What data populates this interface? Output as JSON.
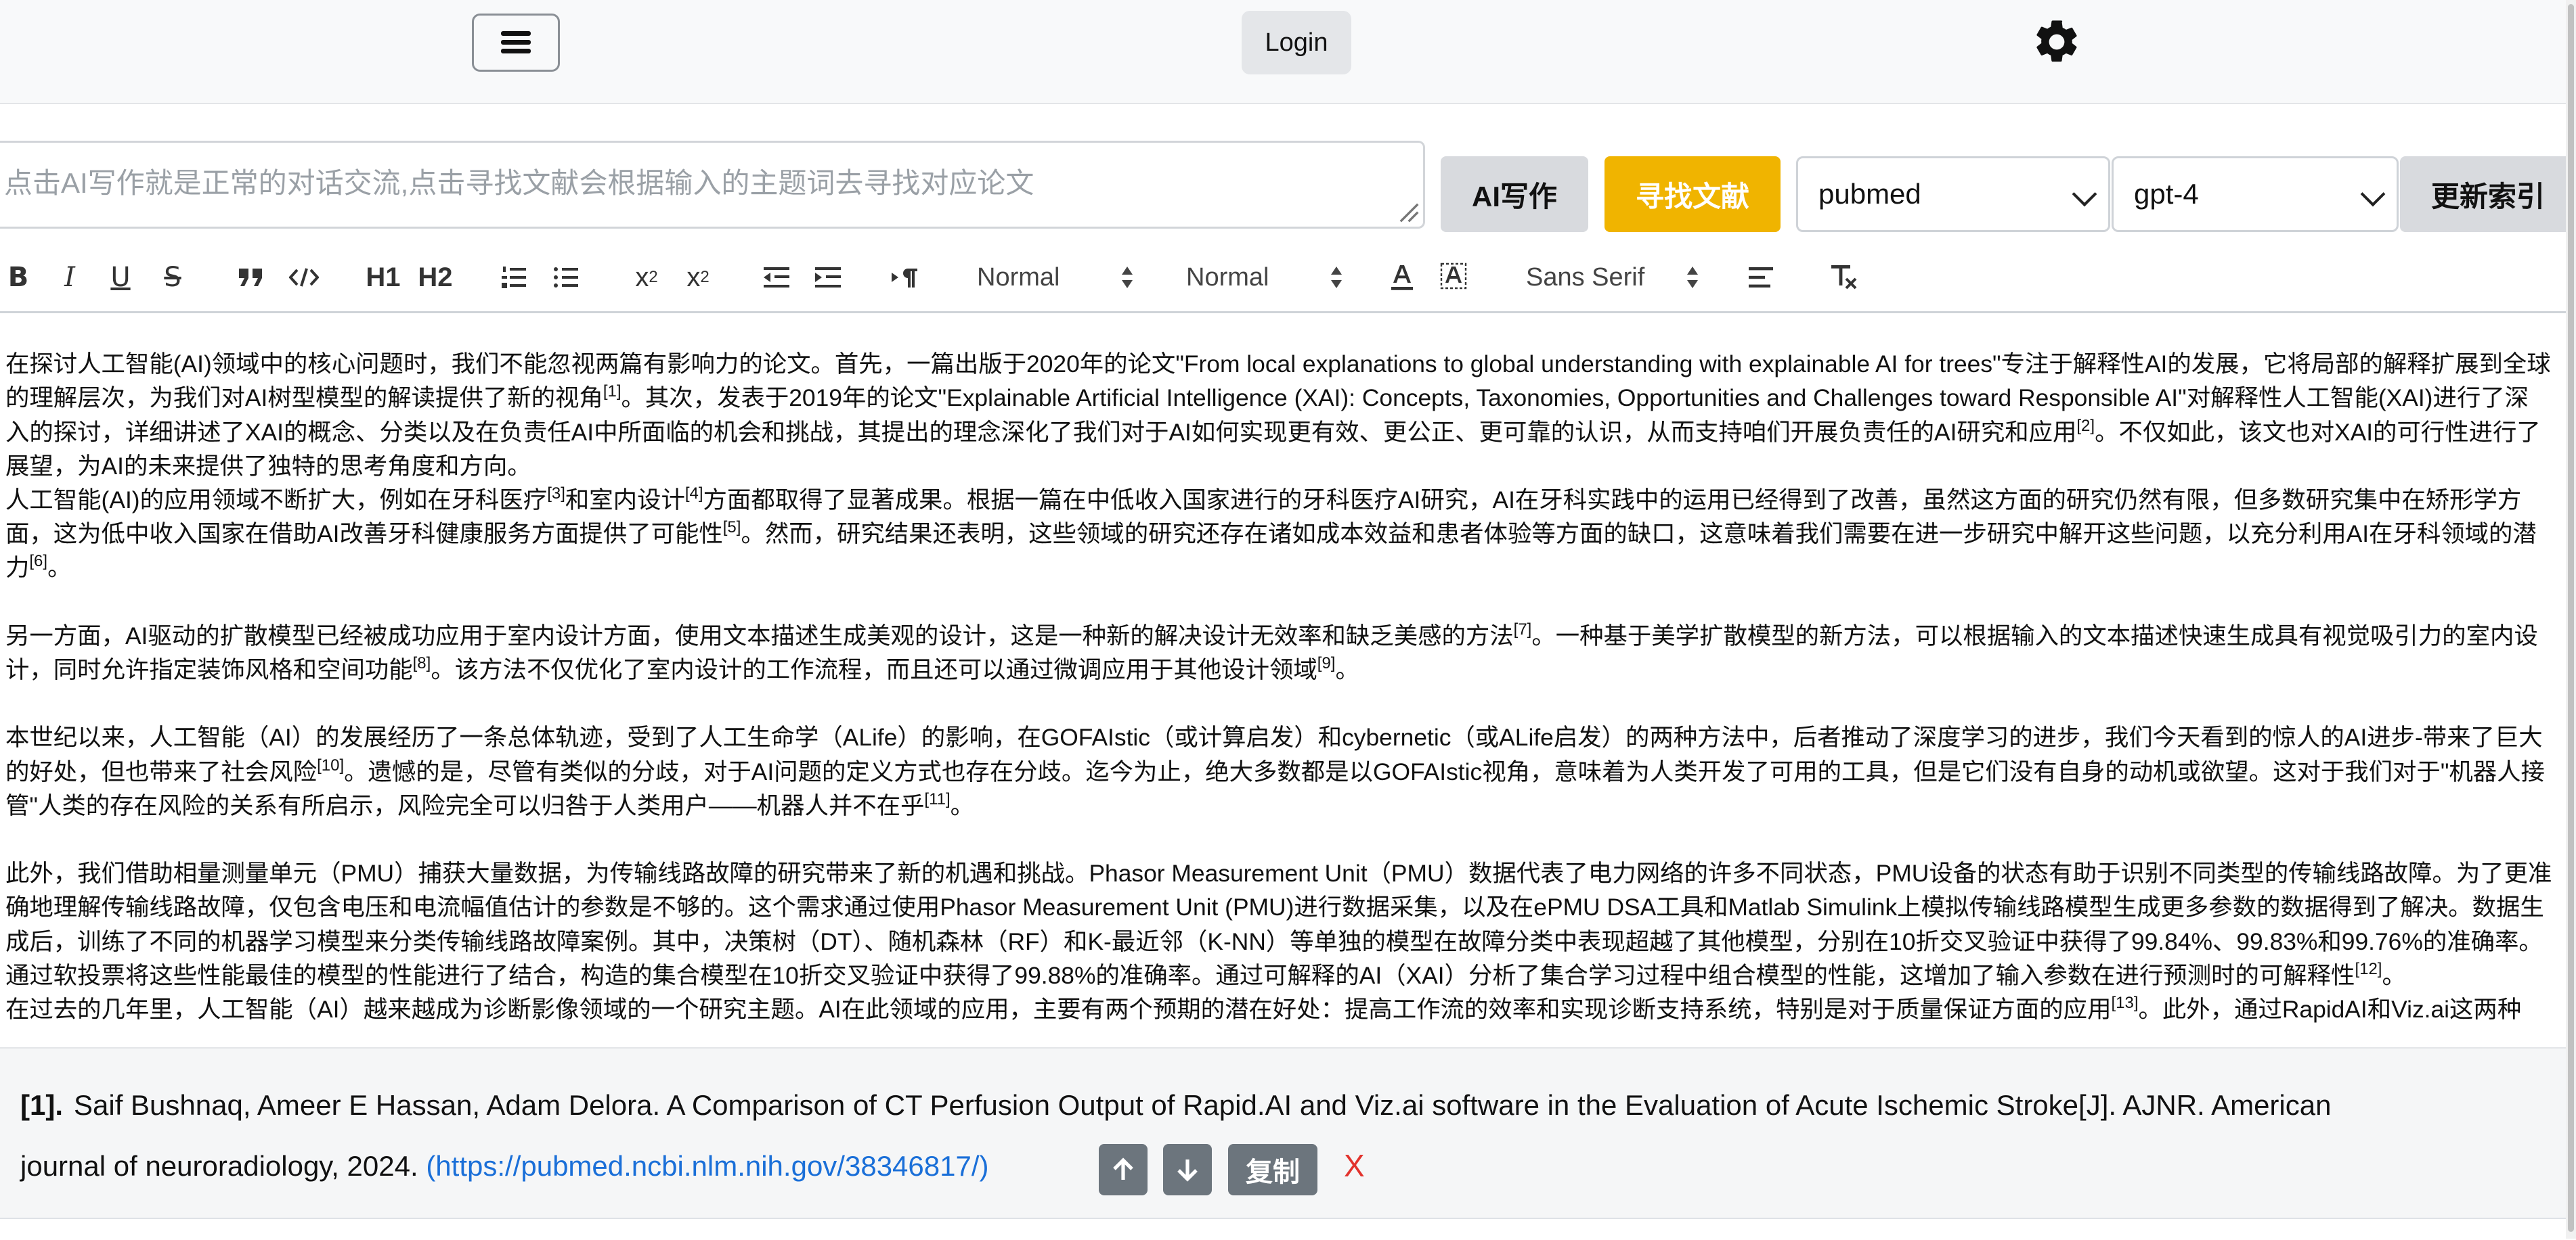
{
  "nav": {
    "login_label": "Login"
  },
  "prompt": {
    "placeholder": "点击AI写作就是正常的对话交流,点击寻找文献会根据输入的主题词去寻找对应论文",
    "value": ""
  },
  "actions": {
    "write_label": "AI写作",
    "find_label": "寻找文献",
    "reindex_label": "更新索引"
  },
  "selects": {
    "database": "pubmed",
    "model": "gpt-4"
  },
  "toolbar": {
    "bold": "B",
    "italic": "I",
    "underline": "U",
    "strike": "S",
    "h1": "H1",
    "h2": "H2",
    "sub": "x2",
    "sup": "x2",
    "size_picker": "Normal",
    "header_picker": "Normal",
    "font_picker": "Sans Serif"
  },
  "icons": [
    "menu-icon",
    "gear-icon",
    "blockquote-icon",
    "code-icon",
    "ordered-list-icon",
    "bullet-list-icon",
    "outdent-icon",
    "indent-icon",
    "rtl-icon",
    "text-color-icon",
    "background-color-icon",
    "align-icon",
    "clear-format-icon",
    "arrow-up-icon",
    "arrow-down-icon",
    "close-icon"
  ],
  "colors": {
    "accent": "#f0b400",
    "link": "#1a6fd8",
    "close": "#e2332d",
    "secondary": "#6c757d"
  },
  "editor": {
    "p1": [
      "在探讨人工智能(AI)领域中的核心问题时，我们不能忽视两篇有影响力的论文。首先，一篇出版于2020年的论文\"From local explanations to global understanding with explainable AI for trees\"专注于解释性AI的发展，它将局部的解释扩展到全球的理解层次，为我们对AI树型模型的解读提供了新的视角",
      "[1]",
      "。其次，发表于2019年的论文\"Explainable Artificial Intelligence (XAI): Concepts, Taxonomies, Opportunities and Challenges toward Responsible AI\"对解释性人工智能(XAI)进行了深入的探讨，详细讲述了XAI的概念、分类以及在负责任AI中所面临的机会和挑战，其提出的理念深化了我们对于AI如何实现更有效、更公正、更可靠的认识，从而支持咱们开展负责任的AI研究和应用",
      "[2]",
      "。不仅如此，该文也对XAI的可行性进行了展望，为AI的未来提供了独特的思考角度和方向。"
    ],
    "p2": [
      "人工智能(AI)的应用领域不断扩大，例如在牙科医疗",
      "[3]",
      "和室内设计",
      "[4]",
      "方面都取得了显著成果。根据一篇在中低收入国家进行的牙科医疗AI研究，AI在牙科实践中的运用已经得到了改善，虽然这方面的研究仍然有限，但多数研究集中在矫形学方面，这为低中收入国家在借助AI改善牙科健康服务方面提供了可能性",
      "[5]",
      "。然而，研究结果还表明，这些领域的研究还存在诸如成本效益和患者体验等方面的缺口，这意味着我们需要在进一步研究中解开这些问题，以充分利用AI在牙科领域的潜力",
      "[6]",
      "。"
    ],
    "p3": [
      "另一方面，AI驱动的扩散模型已经被成功应用于室内设计方面，使用文本描述生成美观的设计，这是一种新的解决设计无效率和缺乏美感的方法",
      "[7]",
      "。一种基于美学扩散模型的新方法，可以根据输入的文本描述快速生成具有视觉吸引力的室内设计，同时允许指定装饰风格和空间功能",
      "[8]",
      "。该方法不仅优化了室内设计的工作流程，而且还可以通过微调应用于其他设计领域",
      "[9]",
      "。"
    ],
    "p4": [
      "本世纪以来，人工智能（AI）的发展经历了一条总体轨迹，受到了人工生命学（ALife）的影响，在GOFAIstic（或计算启发）和cybernetic（或ALife启发）的两种方法中，后者推动了深度学习的进步，我们今天看到的惊人的AI进步-带来了巨大的好处，但也带来了社会风险",
      "[10]",
      "。遗憾的是，尽管有类似的分歧，对于AI问题的定义方式也存在分歧。迄今为止，绝大多数都是以GOFAIstic视角，意味着为人类开发了可用的工具，但是它们没有自身的动机或欲望。这对于我们对于\"机器人接管\"人类的存在风险的关系有所启示，风险完全可以归咎于人类用户——机器人并不在乎",
      "[11]",
      "。"
    ],
    "p5": [
      "此外，我们借助相量测量单元（PMU）捕获大量数据，为传输线路故障的研究带来了新的机遇和挑战。Phasor Measurement Unit（PMU）数据代表了电力网络的许多不同状态，PMU设备的状态有助于识别不同类型的传输线路故障。为了更准确地理解传输线路故障，仅包含电压和电流幅值估计的参数是不够的。这个需求通过使用Phasor Measurement Unit (PMU)进行数据采集，以及在ePMU DSA工具和Matlab Simulink上模拟传输线路模型生成更多参数的数据得到了解决。数据生成后，训练了不同的机器学习模型来分类传输线路故障案例。其中，决策树（DT）、随机森林（RF）和K-最近邻（K-NN）等单独的模型在故障分类中表现超越了其他模型，分别在10折交叉验证中获得了99.84%、99.83%和99.76%的准确率。通过软投票将这些性能最佳的模型的性能进行了结合，构造的集合模型在10折交叉验证中获得了99.88%的准确率。通过可解释的AI（XAI）分析了集合学习过程中组合模型的性能，这增加了输入参数在进行预测时的可解释性",
      "[12]",
      "。"
    ],
    "p6": [
      "在过去的几年里，人工智能（AI）越来越成为诊断影像领域的一个研究主题。AI在此领域的应用，主要有两个预期的潜在好处：提高工作流的效率和实现诊断支持系统，特别是对于质量保证方面的应用",
      "[13]",
      "。此外，通过RapidAI和Viz.ai这两种"
    ]
  },
  "reference": {
    "index": "[1].",
    "text_line1": "Saif Bushnaq, Ameer E Hassan, Adam Delora. A Comparison of CT Perfusion Output of Rapid.AI and Viz.ai software in the Evaluation of Acute Ischemic Stroke[J]. AJNR. American",
    "text_line2": "journal of neuroradiology, 2024. ",
    "link": "(https://pubmed.ncbi.nlm.nih.gov/38346817/)",
    "copy_label": "复制",
    "close_label": "X"
  }
}
